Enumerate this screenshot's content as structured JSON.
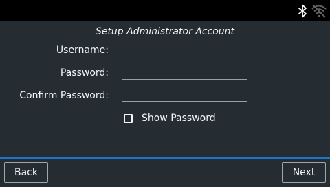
{
  "status_bar": {
    "icons": [
      "bluetooth-icon",
      "wifi-disconnected-icon"
    ],
    "background": "#000000"
  },
  "title": "Setup Administrator Account",
  "form": {
    "username": {
      "label": "Username:",
      "value": ""
    },
    "password": {
      "label": "Password:",
      "value": ""
    },
    "confirm_password": {
      "label": "Confirm Password:",
      "value": ""
    },
    "show_password": {
      "label": "Show Password",
      "checked": false
    }
  },
  "footer": {
    "back_label": "Back",
    "next_label": "Next"
  },
  "colors": {
    "background": "#252d33",
    "accent_divider": "#1a74c9",
    "text": "#f2f4f5"
  }
}
